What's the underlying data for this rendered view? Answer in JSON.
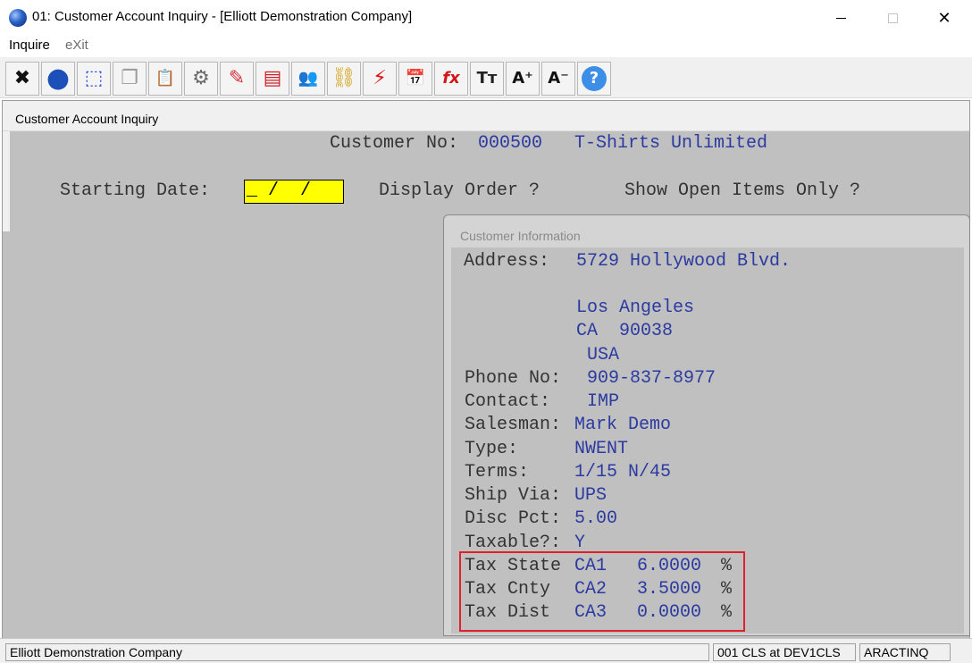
{
  "window": {
    "title": "01: Customer Account Inquiry - [Elliott Demonstration Company]",
    "close_glyph": "✕"
  },
  "menu": {
    "inquire": "Inquire",
    "exit": "eXit"
  },
  "toolbar": {
    "buttons": [
      {
        "name": "cancel-x-icon",
        "glyph": "✖",
        "color": "#111111"
      },
      {
        "name": "globe-icon",
        "glyph": "●",
        "color": "#1d4fb8"
      },
      {
        "name": "select-box-icon",
        "glyph": "⬚",
        "color": "#2a4cd6"
      },
      {
        "name": "copy-icon",
        "glyph": "❐",
        "color": "#9a9a9a"
      },
      {
        "name": "paste-clipboard-icon",
        "glyph": "📋",
        "color": "#b58a3a"
      },
      {
        "name": "gear-icon",
        "glyph": "⚙",
        "color": "#6a6a6a"
      },
      {
        "name": "edit-pencil-icon",
        "glyph": "✎",
        "color": "#d0323a"
      },
      {
        "name": "table-icon",
        "glyph": "▤",
        "color": "#d0202a"
      },
      {
        "name": "users-icon",
        "glyph": "👥",
        "color": "#d0303a"
      },
      {
        "name": "link-chain-icon",
        "glyph": "⛓",
        "color": "#d4a017"
      },
      {
        "name": "lightning-icon",
        "glyph": "⚡",
        "color": "#e01010"
      },
      {
        "name": "calendar-lightning-icon",
        "glyph": "📅",
        "color": "#2a6cc0"
      },
      {
        "name": "function-fx-icon",
        "glyph": "fx",
        "color": "#d01818"
      },
      {
        "name": "text-size-icon",
        "glyph": "Tт",
        "color": "#222222"
      },
      {
        "name": "font-increase-icon",
        "glyph": "A⁺",
        "color": "#111111"
      },
      {
        "name": "font-decrease-icon",
        "glyph": "A⁻",
        "color": "#111111"
      },
      {
        "name": "help-question-icon",
        "glyph": "?",
        "color": "#2f7fe0"
      }
    ]
  },
  "inquiry": {
    "caption": "Customer Account Inquiry",
    "customer_no_label": "Customer No:",
    "customer_no": "000500",
    "customer_name": "T-Shirts Unlimited",
    "starting_date_label": "Starting Date:",
    "starting_date_value": "_ /  /",
    "display_order_label": "Display Order ?",
    "show_open_label": "Show Open Items Only ?"
  },
  "customer_info": {
    "caption": "Customer Information",
    "address_label": "Address:",
    "address_line1": "5729 Hollywood Blvd.",
    "city": "Los Angeles",
    "state_zip": "CA  90038",
    "country": "USA",
    "phone_label": "Phone No:",
    "phone": "909-837-8977",
    "contact_label": "Contact:",
    "contact": "IMP",
    "salesman_label": "Salesman:",
    "salesman": "Mark Demo",
    "type_label": "Type:",
    "type": "NWENT",
    "terms_label": "Terms:",
    "terms": "1/15 N/45",
    "ship_via_label": "Ship Via:",
    "ship_via": "UPS",
    "disc_pct_label": "Disc Pct:",
    "disc_pct": "5.00",
    "taxable_label": "Taxable?:",
    "taxable": "Y",
    "tax_rows": [
      {
        "label": "Tax State",
        "code": "CA1",
        "rate": "6.0000",
        "unit": "%"
      },
      {
        "label": "Tax Cnty",
        "code": "CA2",
        "rate": "3.5000",
        "unit": "%"
      },
      {
        "label": "Tax Dist",
        "code": "CA3",
        "rate": "0.0000",
        "unit": "%"
      }
    ]
  },
  "status": {
    "company": "Elliott Demonstration Company",
    "session": "001 CLS at DEV1CLS",
    "program": "ARACTINQ"
  }
}
